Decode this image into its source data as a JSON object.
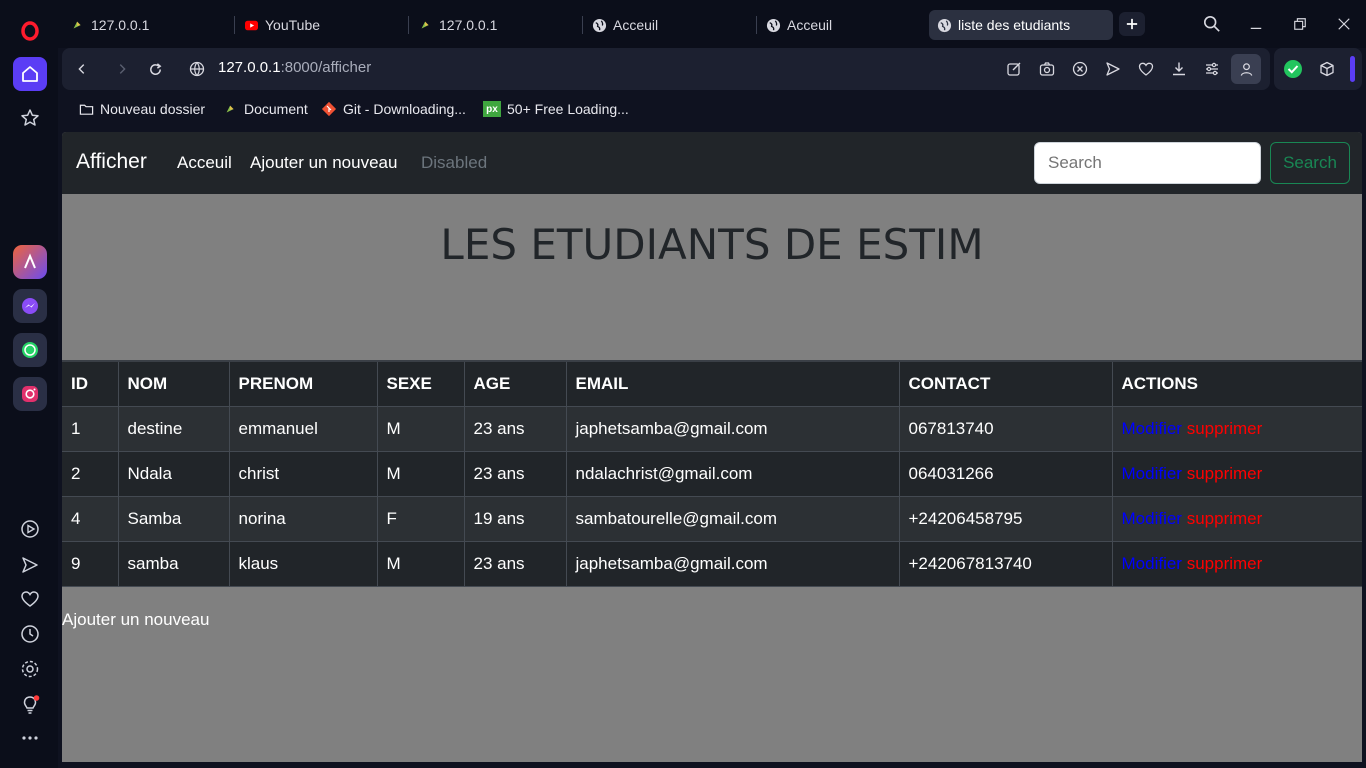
{
  "browser": {
    "tabs": [
      {
        "title": "127.0.0.1",
        "icon": "laravel-icon"
      },
      {
        "title": "YouTube",
        "icon": "youtube-icon"
      },
      {
        "title": "127.0.0.1",
        "icon": "laravel-icon"
      },
      {
        "title": "Acceuil",
        "icon": "globe-icon"
      },
      {
        "title": "Acceuil",
        "icon": "globe-icon"
      },
      {
        "title": "liste des etudiants",
        "icon": "globe-icon",
        "active": true
      }
    ],
    "url": {
      "host": "127.0.0.1",
      "rest": ":8000/afficher"
    },
    "bookmarks": [
      {
        "label": "Nouveau dossier",
        "icon": "folder-icon"
      },
      {
        "label": "Document",
        "icon": "laravel-icon"
      },
      {
        "label": "Git - Downloading...",
        "icon": "git-icon"
      },
      {
        "label": "50+ Free Loading...",
        "icon": "px-icon"
      }
    ],
    "accent": "#5b3df5"
  },
  "navbar": {
    "brand": "Afficher",
    "links": [
      "Acceuil",
      "Ajouter un nouveau"
    ],
    "disabled_link": "Disabled",
    "search_placeholder": "Search",
    "search_button": "Search"
  },
  "heading": "LES ETUDIANTS DE ESTIM",
  "table": {
    "headers": [
      "ID",
      "NOM",
      "PRENOM",
      "SEXE",
      "AGE",
      "EMAIL",
      "CONTACT",
      "ACTIONS"
    ],
    "rows": [
      [
        "1",
        "destine",
        "emmanuel",
        "M",
        "23 ans",
        "japhetsamba@gmail.com",
        "067813740"
      ],
      [
        "2",
        "Ndala",
        "christ",
        "M",
        "23 ans",
        "ndalachrist@gmail.com",
        "064031266"
      ],
      [
        "4",
        "Samba",
        "norina",
        "F",
        "19 ans",
        "sambatourelle@gmail.com",
        "+24206458795"
      ],
      [
        "9",
        "samba",
        "klaus",
        "M",
        "23 ans",
        "japhetsamba@gmail.com",
        "+242067813740"
      ]
    ],
    "action_modify": "Modifier",
    "action_delete": "supprimer"
  },
  "bottom_link": "Ajouter un nouveau"
}
